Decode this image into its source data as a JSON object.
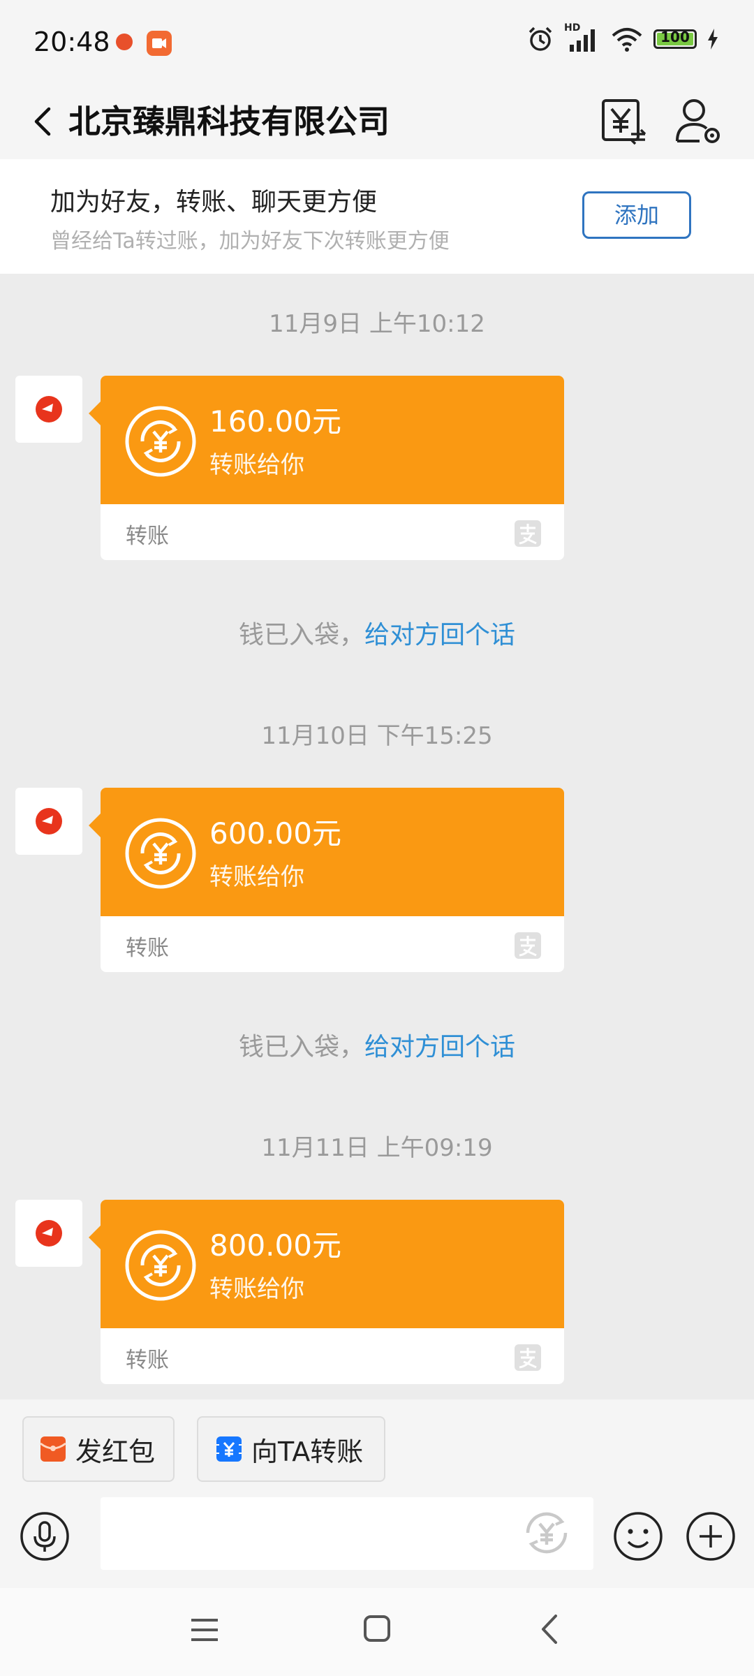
{
  "status_bar": {
    "time": "20:48",
    "battery": "100",
    "network": "HD"
  },
  "header": {
    "title": "北京臻鼎科技有限公司"
  },
  "banner": {
    "title": "加为好友，转账、聊天更方便",
    "subtitle": "曾经给Ta转过账，加为好友下次转账更方便",
    "add_label": "添加"
  },
  "messages": [
    {
      "time": "11月9日 上午10:12",
      "amount": "160.00元",
      "desc": "转账给你",
      "footer": "转账",
      "received_text": "钱已入袋，",
      "reply_link": "给对方回个话"
    },
    {
      "time": "11月10日 下午15:25",
      "amount": "600.00元",
      "desc": "转账给你",
      "footer": "转账",
      "received_text": "钱已入袋，",
      "reply_link": "给对方回个话"
    },
    {
      "time": "11月11日 上午09:19",
      "amount": "800.00元",
      "desc": "转账给你",
      "footer": "转账"
    }
  ],
  "quick_actions": {
    "red_packet_label": "发红包",
    "transfer_label": "向TA转账"
  },
  "colors": {
    "card_orange": "#fa9912",
    "link_blue": "#2f8fd5",
    "button_blue": "#2f74c0"
  }
}
